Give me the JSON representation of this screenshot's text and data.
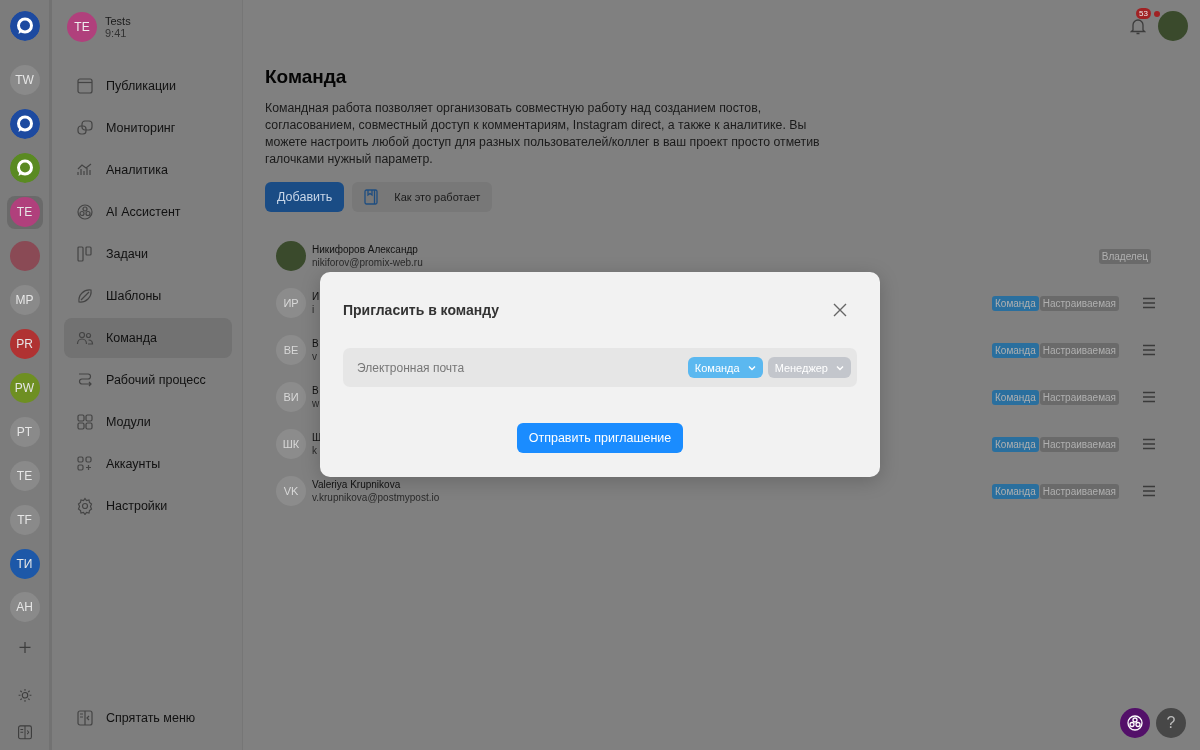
{
  "workspaces": [
    {
      "kind": "logo",
      "color": "#1d4aa0",
      "selected": false
    },
    {
      "kind": "initials",
      "label": "TW",
      "color": "#8a8a8a",
      "selected": false
    },
    {
      "kind": "logo",
      "color": "#1d4aa0",
      "selected": false
    },
    {
      "kind": "logo",
      "color": "#5a8a22",
      "selected": false
    },
    {
      "kind": "initials",
      "label": "TE",
      "color": "#b0407c",
      "selected": true
    },
    {
      "kind": "photo",
      "color": "#8a4a55",
      "selected": false
    },
    {
      "kind": "initials",
      "label": "MP",
      "color": "#8a8a8a",
      "selected": false
    },
    {
      "kind": "initials",
      "label": "PR",
      "color": "#b03232",
      "selected": false
    },
    {
      "kind": "initials",
      "label": "PW",
      "color": "#6e8f22",
      "selected": false
    },
    {
      "kind": "initials",
      "label": "PT",
      "color": "#8a8a8a",
      "selected": false
    },
    {
      "kind": "initials",
      "label": "TE",
      "color": "#8a8a8a",
      "selected": false
    },
    {
      "kind": "initials",
      "label": "TF",
      "color": "#8a8a8a",
      "selected": false
    },
    {
      "kind": "initials",
      "label": "ТИ",
      "color": "#1d58a8",
      "selected": false
    },
    {
      "kind": "initials",
      "label": "AH",
      "color": "#8a8a8a",
      "selected": false
    }
  ],
  "project": {
    "initials": "TE",
    "name": "Tests",
    "time": "9:41"
  },
  "nav": [
    {
      "label": "Публикации",
      "selected": false
    },
    {
      "label": "Мониторинг",
      "selected": false
    },
    {
      "label": "Аналитика",
      "selected": false
    },
    {
      "label": "AI Ассистент",
      "selected": false
    },
    {
      "label": "Задачи",
      "selected": false
    },
    {
      "label": "Шаблоны",
      "selected": false
    },
    {
      "label": "Команда",
      "selected": true
    },
    {
      "label": "Рабочий процесс",
      "selected": false
    },
    {
      "label": "Модули",
      "selected": false
    },
    {
      "label": "Аккаунты",
      "selected": false
    },
    {
      "label": "Настройки",
      "selected": false
    }
  ],
  "hide_menu": "Спрятать меню",
  "notifications": {
    "count": "53"
  },
  "page": {
    "title": "Команда",
    "description": "Командная работа позволяет организовать совместную работу над созданием постов, согласованием, совместный доступ к комментариям, Instagram direct, а также к аналитике. Вы можете настроить любой доступ для разных пользователей/коллег в ваш проект просто отметив галочками нужный параметр.",
    "add_button": "Добавить",
    "help_button": "Как это работает"
  },
  "members": [
    {
      "kind": "photo",
      "name": "Никифоров Александр",
      "email": "nikiforov@promix-web.ru",
      "tags": [
        {
          "label": "Владелец",
          "color": "#6a6a6a"
        }
      ],
      "menu": false
    },
    {
      "kind": "initials",
      "initials": "ИР",
      "name": "И",
      "email": "i",
      "tags": [
        {
          "label": "Команда",
          "color": "#2a6f9e"
        },
        {
          "label": "Настраиваемая",
          "color": "#6a6a6a"
        }
      ],
      "menu": true
    },
    {
      "kind": "initials",
      "initials": "ВЕ",
      "name": "В",
      "email": "v",
      "tags": [
        {
          "label": "Команда",
          "color": "#2a6f9e"
        },
        {
          "label": "Настраиваемая",
          "color": "#6a6a6a"
        }
      ],
      "menu": true
    },
    {
      "kind": "initials",
      "initials": "ВИ",
      "name": "В",
      "email": "w",
      "tags": [
        {
          "label": "Команда",
          "color": "#2a6f9e"
        },
        {
          "label": "Настраиваемая",
          "color": "#6a6a6a"
        }
      ],
      "menu": true
    },
    {
      "kind": "initials",
      "initials": "ШК",
      "name": "Ш",
      "email": "k",
      "tags": [
        {
          "label": "Команда",
          "color": "#2a6f9e"
        },
        {
          "label": "Настраиваемая",
          "color": "#6a6a6a"
        }
      ],
      "menu": true
    },
    {
      "kind": "initials",
      "initials": "VK",
      "name": "Valeriya Krupnikova",
      "email": "v.krupnikova@postmypost.io",
      "tags": [
        {
          "label": "Команда",
          "color": "#2a6f9e"
        },
        {
          "label": "Настраиваемая",
          "color": "#6a6a6a"
        }
      ],
      "menu": true
    }
  ],
  "modal": {
    "title": "Пригласить в команду",
    "email_placeholder": "Электронная почта",
    "dropdowns": [
      {
        "label": "Команда",
        "color": "#5bb8f0"
      },
      {
        "label": "Менеджер",
        "color": "#c3c6cc"
      }
    ],
    "submit": "Отправить приглашение"
  },
  "help_fab": "?"
}
